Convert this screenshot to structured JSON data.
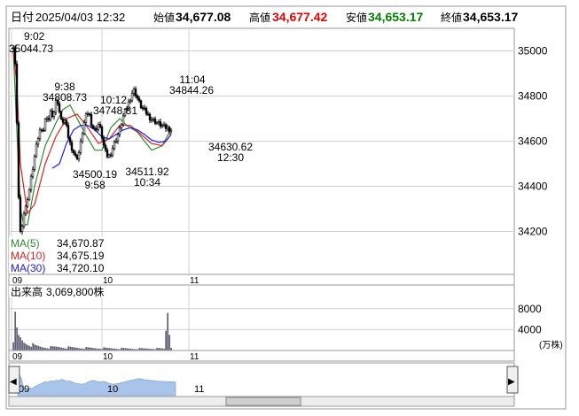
{
  "header": {
    "date_label": "日付",
    "datetime": "2025/04/03 12:32",
    "open_label": "始値",
    "open": "34,677.08",
    "high_label": "高値",
    "high": "34,677.42",
    "low_label": "安値",
    "low": "34,653.17",
    "close_label": "終値",
    "close": "34,653.17"
  },
  "colors": {
    "candle_up": "#ffffff",
    "candle_down": "#000000",
    "ma5": "#2e8b2e",
    "ma10": "#e02020",
    "ma30": "#1a1aff",
    "high_text": "#e60000",
    "low_text": "#008000",
    "grid": "#d0d0d0",
    "mini_fill": "#a8c4ea"
  },
  "chart_data": {
    "type": "candlestick",
    "yticks": [
      34200,
      34400,
      34600,
      34800,
      35000
    ],
    "ylim": [
      34010,
      35100
    ],
    "xticks": [
      "09",
      "10",
      "11"
    ],
    "annotations": [
      {
        "time": "9:02",
        "value": "35044.73",
        "kind": "high"
      },
      {
        "time": "9:38",
        "value": "34808.73",
        "kind": "high"
      },
      {
        "time": "10:12",
        "value": "34748.81",
        "kind": "high"
      },
      {
        "time": "11:04",
        "value": "34844.26",
        "kind": "high"
      },
      {
        "time": "9:58",
        "value": "34500.19",
        "kind": "low"
      },
      {
        "time": "10:34",
        "value": "34511.92",
        "kind": "low"
      },
      {
        "time": "12:30",
        "value": "34630.62",
        "kind": "low"
      }
    ],
    "ma": [
      {
        "name": "MA(5)",
        "value": "34,670.87",
        "anchors": [
          [
            0,
            35000
          ],
          [
            2,
            34650
          ],
          [
            4,
            34300
          ],
          [
            6,
            34230
          ],
          [
            8,
            34230
          ],
          [
            12,
            34400
          ],
          [
            18,
            34580
          ],
          [
            24,
            34680
          ],
          [
            28,
            34740
          ],
          [
            32,
            34760
          ],
          [
            36,
            34700
          ],
          [
            40,
            34640
          ],
          [
            46,
            34560
          ],
          [
            50,
            34560
          ],
          [
            55,
            34660
          ],
          [
            60,
            34700
          ],
          [
            64,
            34670
          ],
          [
            70,
            34640
          ],
          [
            74,
            34600
          ],
          [
            78,
            34560
          ],
          [
            84,
            34580
          ],
          [
            88,
            34640
          ],
          [
            92,
            34700
          ],
          [
            96,
            34760
          ],
          [
            100,
            34800
          ],
          [
            104,
            34760
          ],
          [
            108,
            34720
          ],
          [
            114,
            34700
          ],
          [
            118,
            34685
          ],
          [
            124,
            34670
          ]
        ]
      },
      {
        "name": "MA(10)",
        "value": "34,675.19",
        "anchors": [
          [
            0,
            35000
          ],
          [
            2,
            34850
          ],
          [
            4,
            34500
          ],
          [
            8,
            34280
          ],
          [
            12,
            34320
          ],
          [
            18,
            34500
          ],
          [
            24,
            34620
          ],
          [
            30,
            34700
          ],
          [
            36,
            34720
          ],
          [
            42,
            34660
          ],
          [
            48,
            34590
          ],
          [
            54,
            34610
          ],
          [
            60,
            34670
          ],
          [
            66,
            34670
          ],
          [
            72,
            34630
          ],
          [
            78,
            34590
          ],
          [
            84,
            34580
          ],
          [
            88,
            34620
          ],
          [
            92,
            34680
          ],
          [
            96,
            34740
          ],
          [
            100,
            34780
          ],
          [
            104,
            34770
          ],
          [
            110,
            34740
          ],
          [
            116,
            34710
          ],
          [
            124,
            34690
          ]
        ]
      },
      {
        "name": "MA(30)",
        "value": "34,720.10",
        "anchors": [
          [
            22,
            34480
          ],
          [
            26,
            34500
          ],
          [
            30,
            34590
          ],
          [
            34,
            34650
          ],
          [
            38,
            34670
          ],
          [
            42,
            34670
          ],
          [
            46,
            34650
          ],
          [
            50,
            34620
          ],
          [
            54,
            34610
          ],
          [
            58,
            34630
          ],
          [
            62,
            34650
          ],
          [
            66,
            34660
          ],
          [
            70,
            34650
          ],
          [
            74,
            34630
          ],
          [
            78,
            34605
          ],
          [
            82,
            34595
          ],
          [
            86,
            34600
          ],
          [
            90,
            34640
          ],
          [
            94,
            34680
          ],
          [
            98,
            34700
          ],
          [
            102,
            34720
          ],
          [
            108,
            34740
          ],
          [
            114,
            34750
          ],
          [
            118,
            34740
          ],
          [
            124,
            34725
          ]
        ]
      }
    ],
    "volume": {
      "label": "出来高",
      "value": "3,069,800株",
      "yticks": [
        4000,
        8000
      ],
      "unit": "(万株)",
      "ymax": 10000
    }
  },
  "candle_anchors": [
    [
      0,
      35010
    ],
    [
      1,
      35040
    ],
    [
      2,
      34850
    ],
    [
      3,
      34500
    ],
    [
      4,
      34220
    ],
    [
      5,
      34180
    ],
    [
      6,
      34250
    ],
    [
      7,
      34320
    ],
    [
      8,
      34300
    ],
    [
      9,
      34360
    ],
    [
      10,
      34420
    ],
    [
      11,
      34460
    ],
    [
      12,
      34510
    ],
    [
      13,
      34560
    ],
    [
      14,
      34600
    ],
    [
      15,
      34640
    ],
    [
      16,
      34660
    ],
    [
      17,
      34620
    ],
    [
      18,
      34690
    ],
    [
      19,
      34700
    ],
    [
      20,
      34680
    ],
    [
      21,
      34720
    ],
    [
      22,
      34740
    ],
    [
      23,
      34700
    ],
    [
      24,
      34760
    ],
    [
      25,
      34790
    ],
    [
      26,
      34760
    ],
    [
      27,
      34700
    ],
    [
      28,
      34680
    ],
    [
      29,
      34700
    ],
    [
      30,
      34680
    ],
    [
      31,
      34640
    ],
    [
      32,
      34600
    ],
    [
      33,
      34580
    ],
    [
      34,
      34560
    ],
    [
      35,
      34540
    ],
    [
      36,
      34520
    ],
    [
      37,
      34540
    ],
    [
      38,
      34560
    ],
    [
      39,
      34620
    ],
    [
      40,
      34660
    ],
    [
      41,
      34700
    ],
    [
      42,
      34720
    ],
    [
      43,
      34730
    ],
    [
      44,
      34700
    ],
    [
      45,
      34660
    ],
    [
      46,
      34660
    ],
    [
      47,
      34640
    ],
    [
      48,
      34680
    ],
    [
      49,
      34670
    ],
    [
      50,
      34640
    ],
    [
      51,
      34600
    ],
    [
      52,
      34560
    ],
    [
      53,
      34540
    ],
    [
      54,
      34530
    ],
    [
      55,
      34540
    ],
    [
      56,
      34560
    ],
    [
      57,
      34580
    ],
    [
      58,
      34600
    ],
    [
      59,
      34620
    ],
    [
      60,
      34640
    ],
    [
      61,
      34660
    ],
    [
      62,
      34700
    ],
    [
      63,
      34720
    ],
    [
      64,
      34740
    ],
    [
      65,
      34760
    ],
    [
      66,
      34780
    ],
    [
      67,
      34800
    ],
    [
      68,
      34830
    ],
    [
      69,
      34820
    ],
    [
      70,
      34800
    ],
    [
      71,
      34780
    ],
    [
      72,
      34760
    ],
    [
      73,
      34750
    ],
    [
      74,
      34740
    ],
    [
      75,
      34730
    ],
    [
      76,
      34720
    ],
    [
      77,
      34710
    ],
    [
      78,
      34700
    ],
    [
      79,
      34695
    ],
    [
      80,
      34690
    ],
    [
      81,
      34685
    ],
    [
      82,
      34680
    ],
    [
      83,
      34675
    ],
    [
      84,
      34670
    ],
    [
      85,
      34665
    ],
    [
      86,
      34660
    ],
    [
      87,
      34660
    ],
    [
      88,
      34655
    ],
    [
      89,
      34650
    ]
  ],
  "volume_anchors": [
    [
      0,
      2600
    ],
    [
      1,
      5500
    ],
    [
      2,
      3500
    ],
    [
      3,
      2500
    ],
    [
      4,
      2300
    ],
    [
      5,
      1900
    ],
    [
      6,
      1600
    ],
    [
      8,
      1400
    ],
    [
      10,
      1200
    ],
    [
      12,
      900
    ],
    [
      16,
      700
    ],
    [
      20,
      600
    ],
    [
      25,
      700
    ],
    [
      30,
      600
    ],
    [
      40,
      500
    ],
    [
      50,
      450
    ],
    [
      60,
      400
    ],
    [
      70,
      350
    ],
    [
      80,
      400
    ],
    [
      85,
      350
    ],
    [
      87,
      7200
    ],
    [
      88,
      3000
    ],
    [
      89,
      500
    ]
  ],
  "navigator": {
    "x_labels": [
      "09",
      "10",
      "11"
    ],
    "scroll_left": "◀",
    "scroll_right": "▶"
  }
}
